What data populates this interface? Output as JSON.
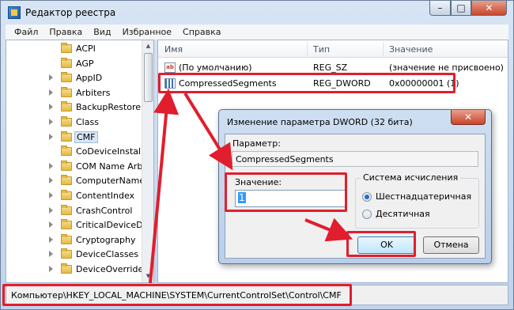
{
  "window": {
    "title": "Редактор реестра",
    "min": "–",
    "max": "□",
    "close": "✕"
  },
  "menu": [
    "Файл",
    "Правка",
    "Вид",
    "Избранное",
    "Справка"
  ],
  "tree": {
    "items": [
      {
        "label": "ACPI",
        "arrow": false
      },
      {
        "label": "AGP",
        "arrow": false
      },
      {
        "label": "AppID",
        "arrow": true
      },
      {
        "label": "Arbiters",
        "arrow": true
      },
      {
        "label": "BackupRestore",
        "arrow": true
      },
      {
        "label": "Class",
        "arrow": true
      },
      {
        "label": "CMF",
        "arrow": true,
        "selected": true
      },
      {
        "label": "CoDeviceInstalle",
        "arrow": false
      },
      {
        "label": "COM Name Arb",
        "arrow": true
      },
      {
        "label": "ComputerName",
        "arrow": true
      },
      {
        "label": "ContentIndex",
        "arrow": true
      },
      {
        "label": "CrashControl",
        "arrow": true
      },
      {
        "label": "CriticalDeviceDa",
        "arrow": true
      },
      {
        "label": "Cryptography",
        "arrow": true
      },
      {
        "label": "DeviceClasses",
        "arrow": true
      },
      {
        "label": "DeviceOverrides",
        "arrow": true
      }
    ]
  },
  "list": {
    "headers": {
      "name": "Имя",
      "type": "Тип",
      "value": "Значение"
    },
    "rows": [
      {
        "name": "(По умолчанию)",
        "type": "REG_SZ",
        "value": "(значение не присвоено)",
        "icon": "string-value-icon"
      },
      {
        "name": "CompressedSegments",
        "type": "REG_DWORD",
        "value": "0x00000001 (1)",
        "icon": "dword-value-icon"
      }
    ]
  },
  "status": {
    "path": "Компьютер\\HKEY_LOCAL_MACHINE\\SYSTEM\\CurrentControlSet\\Control\\CMF"
  },
  "dialog": {
    "title": "Изменение параметра DWORD (32 бита)",
    "close": "✕",
    "param_label": "Параметр:",
    "param_value": "CompressedSegments",
    "value_label": "Значение:",
    "value": "1",
    "base_title": "Система исчисления",
    "hex_label": "Шестнадцатеричная",
    "dec_label": "Десятичная",
    "base_selected": "hex",
    "ok": "OK",
    "cancel": "Отмена"
  },
  "colors": {
    "highlight": "#e01e2d",
    "selection": "#3399ff"
  }
}
